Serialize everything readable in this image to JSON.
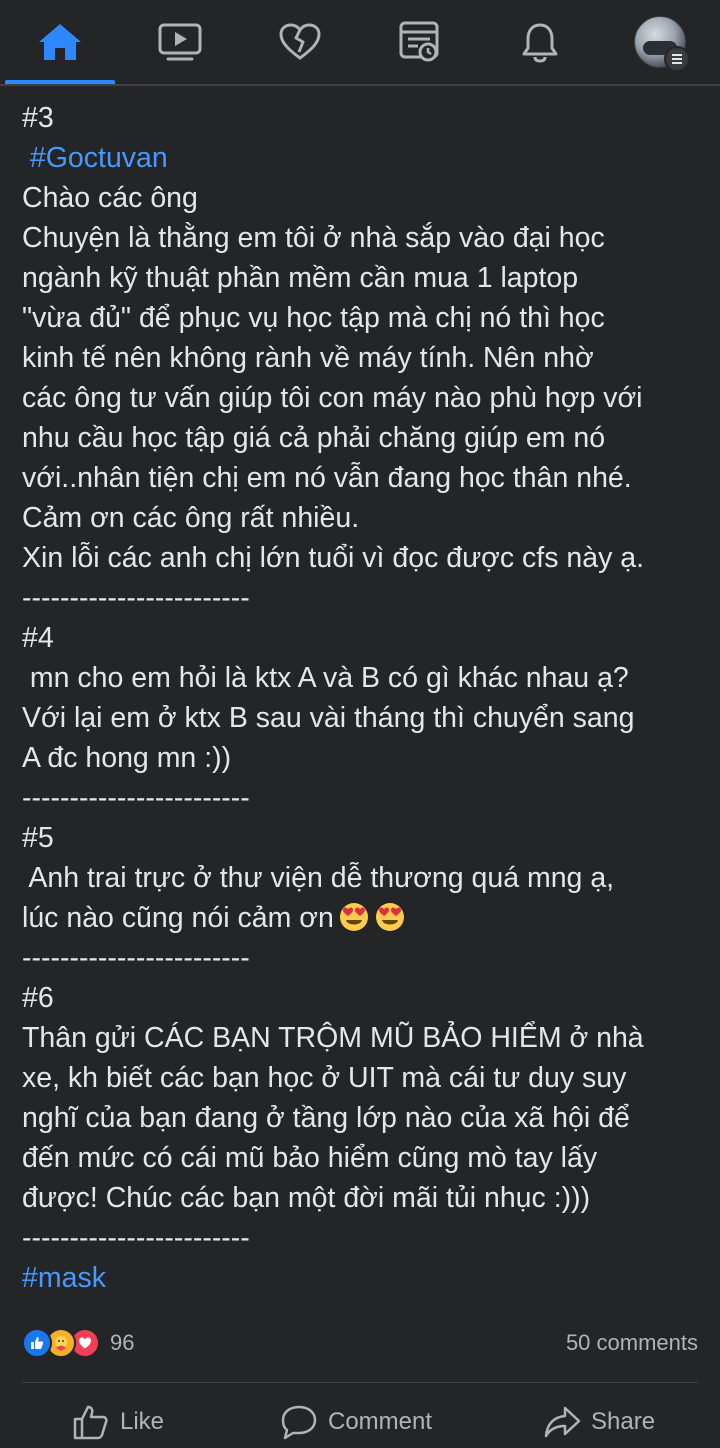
{
  "nav": {
    "items": [
      {
        "name": "home-icon",
        "active": true
      },
      {
        "name": "watch-icon",
        "active": false
      },
      {
        "name": "dating-heart-icon",
        "active": false
      },
      {
        "name": "news-feed-icon",
        "active": false
      },
      {
        "name": "notifications-bell-icon",
        "active": false
      },
      {
        "name": "profile-avatar",
        "active": false
      }
    ],
    "accent_color": "#2d88ff"
  },
  "post": {
    "lines": [
      "#3",
      " #Goctuvan",
      "Chào các ông",
      "Chuyện là thằng em tôi ở nhà sắp vào đại học",
      "ngành kỹ thuật phần mềm cần mua 1 laptop",
      "\"vừa đủ\" để phục vụ học tập mà chị nó thì học",
      "kinh tế nên không rành về máy tính. Nên nhờ",
      "các ông tư vấn giúp tôi con máy nào phù hợp với",
      "nhu cầu học tập giá cả phải chăng giúp em nó",
      "với..nhân tiện chị em nó vẫn đang học thân nhé.",
      "Cảm ơn các ông rất nhiều.",
      "Xin lỗi các anh chị lớn tuổi vì đọc được cfs này ạ.",
      "------------------------",
      "#4",
      " mn cho em hỏi là ktx A và B có gì khác nhau ạ?",
      "Với lại em ở ktx B sau vài tháng thì chuyển sang",
      "A đc hong mn :))",
      "------------------------",
      "#5",
      " Anh trai trực ở thư viện dễ thương quá mng ạ,",
      "lúc nào cũng nói cảm ơn",
      "------------------------",
      "#6",
      "Thân gửi CÁC BẠN TRỘM MŨ BẢO HIỂM ở nhà",
      "xe, kh biết các bạn học ở UIT mà cái tư duy suy",
      "nghĩ của bạn đang ở tầng lớp nào của xã hội để",
      "đến mức có cái mũ bảo hiểm cũng mò tay lấy",
      "được! Chúc các bạn một đời mãi tủi nhục :)))",
      "------------------------",
      "#mask"
    ],
    "hashtag_lines": [
      1,
      29
    ],
    "emoji_line": 20,
    "emoji": "heart-eyes-emoji",
    "hashtag_color": "#4599ff"
  },
  "stats": {
    "reaction_icons": [
      "like-reaction-icon",
      "care-reaction-icon",
      "love-reaction-icon"
    ],
    "reaction_count": "96",
    "comments_count": "50 comments"
  },
  "actions": {
    "like_label": "Like",
    "comment_label": "Comment",
    "share_label": "Share"
  }
}
